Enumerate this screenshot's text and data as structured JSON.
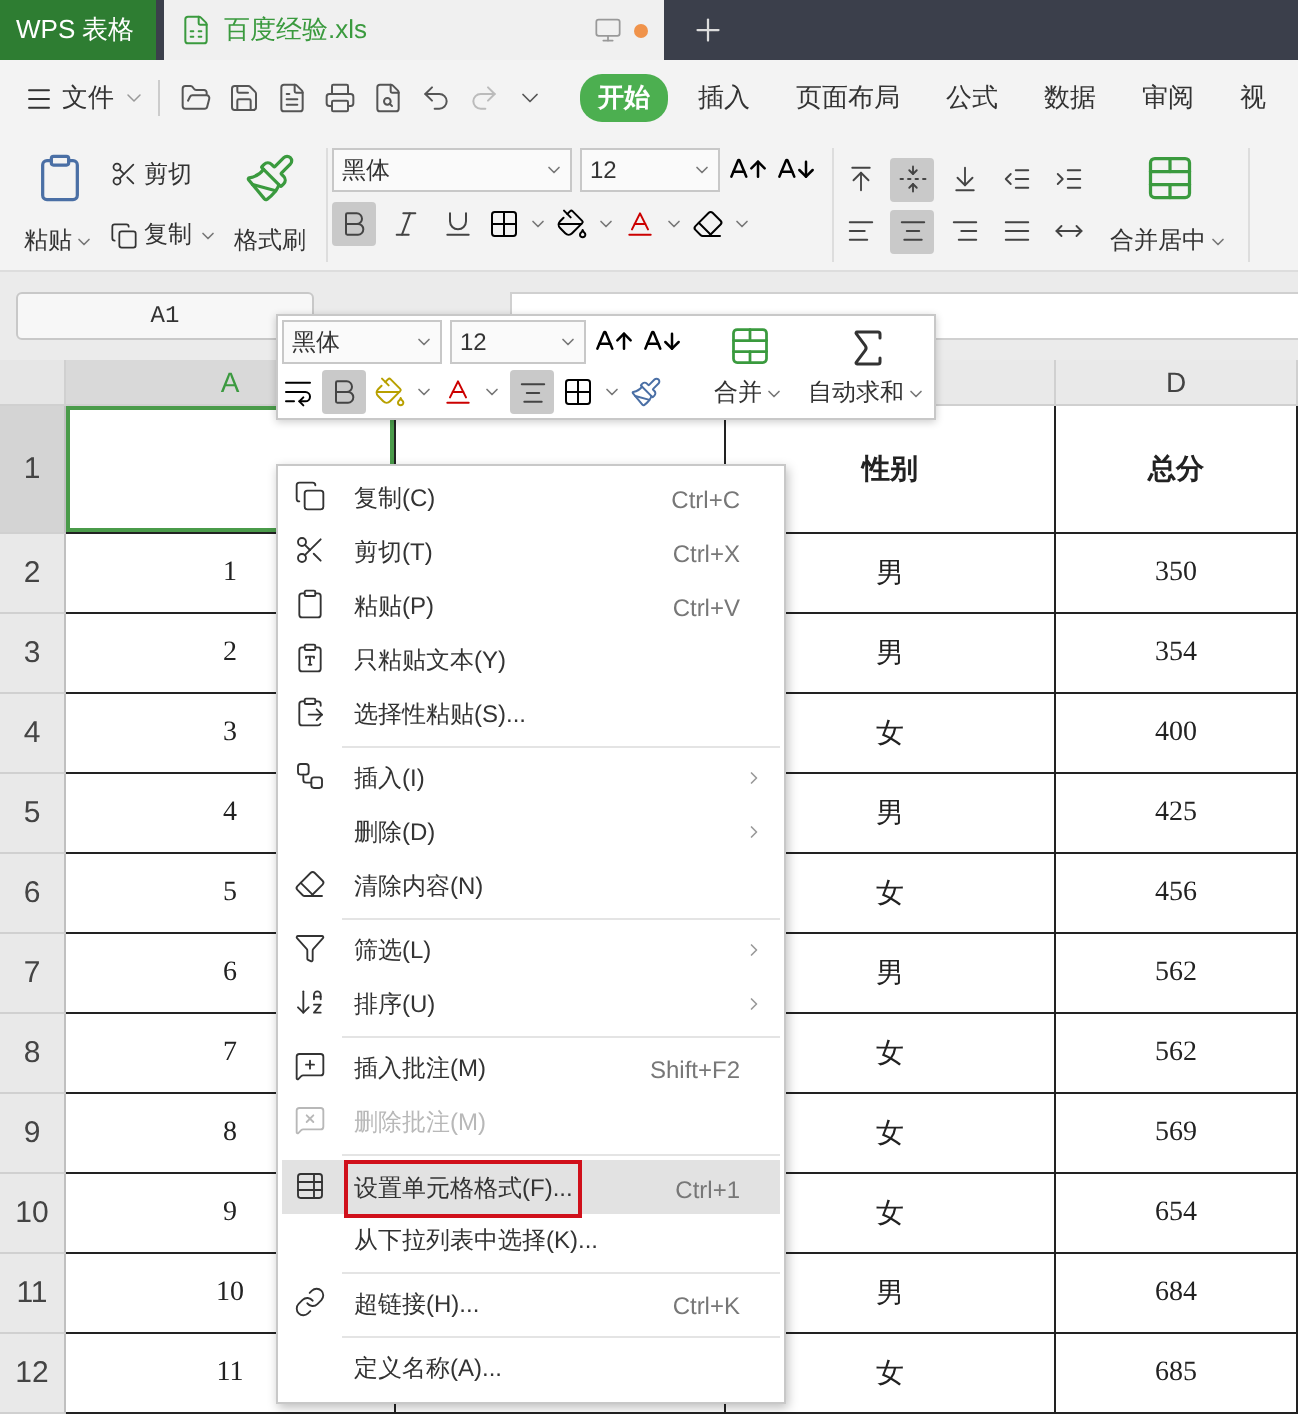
{
  "title_bar": {
    "app_tab": "WPS 表格",
    "doc_tab": {
      "title": "百度经验.xls",
      "unsaved": true
    }
  },
  "menu_bar": {
    "file": "文件",
    "tabs": [
      {
        "label": "开始",
        "selected": true
      },
      {
        "label": "插入",
        "selected": false
      },
      {
        "label": "页面布局",
        "selected": false
      },
      {
        "label": "公式",
        "selected": false
      },
      {
        "label": "数据",
        "selected": false
      },
      {
        "label": "审阅",
        "selected": false
      },
      {
        "label": "视",
        "selected": false
      }
    ]
  },
  "ribbon": {
    "paste": "粘贴",
    "cut": "剪切",
    "copy": "复制",
    "format_painter": "格式刷",
    "font": "黑体",
    "size": "12",
    "bold": true,
    "italic": false,
    "underline": false,
    "alignment": [
      {
        "kind": "top",
        "selected": false
      },
      {
        "kind": "middle",
        "selected": true
      },
      {
        "kind": "bottom",
        "selected": false
      },
      {
        "kind": "outdent",
        "selected": false
      },
      {
        "kind": "indent",
        "selected": false
      },
      {
        "kind": "left",
        "selected": false
      },
      {
        "kind": "center",
        "selected": true
      },
      {
        "kind": "right",
        "selected": false
      },
      {
        "kind": "justify",
        "selected": false
      },
      {
        "kind": "distribute",
        "selected": false
      }
    ],
    "merge": "合并居中"
  },
  "formula_bar": {
    "name_box": "A1"
  },
  "sheet": {
    "columns": [
      {
        "label": "A",
        "selected": true
      },
      {
        "label": "D",
        "selected": false
      }
    ],
    "rows": [
      {
        "number": "1",
        "selected": true,
        "kind": "header",
        "c": "性别",
        "d": "总分"
      },
      {
        "number": "2",
        "selected": false,
        "kind": "data",
        "a": "1",
        "c": "男",
        "d": "350"
      },
      {
        "number": "3",
        "selected": false,
        "kind": "data",
        "a": "2",
        "c": "男",
        "d": "354"
      },
      {
        "number": "4",
        "selected": false,
        "kind": "data",
        "a": "3",
        "c": "女",
        "d": "400"
      },
      {
        "number": "5",
        "selected": false,
        "kind": "data",
        "a": "4",
        "c": "男",
        "d": "425"
      },
      {
        "number": "6",
        "selected": false,
        "kind": "data",
        "a": "5",
        "c": "女",
        "d": "456"
      },
      {
        "number": "7",
        "selected": false,
        "kind": "data",
        "a": "6",
        "c": "男",
        "d": "562"
      },
      {
        "number": "8",
        "selected": false,
        "kind": "data",
        "a": "7",
        "c": "女",
        "d": "562"
      },
      {
        "number": "9",
        "selected": false,
        "kind": "data",
        "a": "8",
        "c": "女",
        "d": "569"
      },
      {
        "number": "10",
        "selected": false,
        "kind": "data",
        "a": "9",
        "c": "女",
        "d": "654"
      },
      {
        "number": "11",
        "selected": false,
        "kind": "data",
        "a": "10",
        "c": "男",
        "d": "684"
      },
      {
        "number": "12",
        "selected": false,
        "kind": "data",
        "a": "11",
        "c": "女",
        "d": "685"
      }
    ]
  },
  "mini_toolbar": {
    "font": "黑体",
    "size": "12",
    "bold": true,
    "align_selected": true,
    "merge": "合并",
    "autosum": "自动求和"
  },
  "context_menu": [
    {
      "kind": "item",
      "label": "复制(C)",
      "shortcut": "Ctrl+C",
      "submenu": false,
      "disabled": false,
      "selected": false,
      "marked": false
    },
    {
      "kind": "item",
      "label": "剪切(T)",
      "shortcut": "Ctrl+X",
      "submenu": false,
      "disabled": false,
      "selected": false,
      "marked": false
    },
    {
      "kind": "item",
      "label": "粘贴(P)",
      "shortcut": "Ctrl+V",
      "submenu": false,
      "disabled": false,
      "selected": false,
      "marked": false
    },
    {
      "kind": "item",
      "label": "只粘贴文本(Y)",
      "submenu": false,
      "disabled": false,
      "selected": false,
      "marked": false
    },
    {
      "kind": "item",
      "label": "选择性粘贴(S)...",
      "submenu": false,
      "disabled": false,
      "selected": false,
      "marked": false
    },
    {
      "kind": "separator"
    },
    {
      "kind": "item",
      "label": "插入(I)",
      "submenu": true,
      "disabled": false,
      "selected": false,
      "marked": false
    },
    {
      "kind": "item",
      "label": "删除(D)",
      "submenu": true,
      "disabled": false,
      "selected": false,
      "marked": false
    },
    {
      "kind": "item",
      "label": "清除内容(N)",
      "submenu": false,
      "disabled": false,
      "selected": false,
      "marked": false
    },
    {
      "kind": "separator"
    },
    {
      "kind": "item",
      "label": "筛选(L)",
      "submenu": true,
      "disabled": false,
      "selected": false,
      "marked": false
    },
    {
      "kind": "item",
      "label": "排序(U)",
      "submenu": true,
      "disabled": false,
      "selected": false,
      "marked": false
    },
    {
      "kind": "separator"
    },
    {
      "kind": "item",
      "label": "插入批注(M)",
      "shortcut": "Shift+F2",
      "submenu": false,
      "disabled": false,
      "selected": false,
      "marked": false
    },
    {
      "kind": "item",
      "label": "删除批注(M)",
      "submenu": false,
      "disabled": true,
      "selected": false,
      "marked": false
    },
    {
      "kind": "separator"
    },
    {
      "kind": "item",
      "label": "设置单元格格式(F)...",
      "shortcut": "Ctrl+1",
      "submenu": false,
      "disabled": false,
      "selected": true,
      "marked": true
    },
    {
      "kind": "item",
      "label": "从下拉列表中选择(K)...",
      "submenu": false,
      "disabled": false,
      "selected": false,
      "marked": false
    },
    {
      "kind": "separator"
    },
    {
      "kind": "item",
      "label": "超链接(H)...",
      "shortcut": "Ctrl+K",
      "submenu": false,
      "disabled": false,
      "selected": false,
      "marked": false
    },
    {
      "kind": "separator"
    },
    {
      "kind": "item",
      "label": "定义名称(A)...",
      "submenu": false,
      "disabled": false,
      "selected": false,
      "marked": false
    }
  ]
}
